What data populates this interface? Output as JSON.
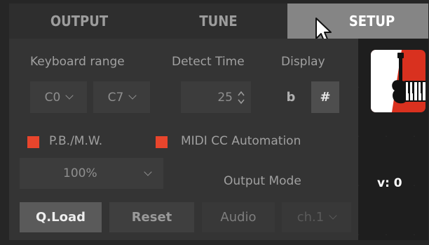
{
  "tabs": [
    {
      "label": "OUTPUT"
    },
    {
      "label": "TUNE"
    },
    {
      "label": "SETUP"
    }
  ],
  "keyboard_range": {
    "label": "Keyboard range",
    "low": "C0",
    "high": "C7"
  },
  "detect_time": {
    "label": "Detect Time",
    "value": "25"
  },
  "display": {
    "label": "Display",
    "flat": "b",
    "sharp": "#"
  },
  "options": {
    "pbmw": "P.B./M.W.",
    "midi_cc": "MIDI CC Automation"
  },
  "amount": {
    "value": "100%"
  },
  "output_mode": {
    "label": "Output Mode"
  },
  "buttons": {
    "qload": "Q.Load",
    "reset": "Reset",
    "audio": "Audio",
    "channel": "ch.1"
  },
  "side": {
    "version": "v: 0"
  },
  "colors": {
    "accent": "#e8452c",
    "logo": "#d9311f"
  }
}
